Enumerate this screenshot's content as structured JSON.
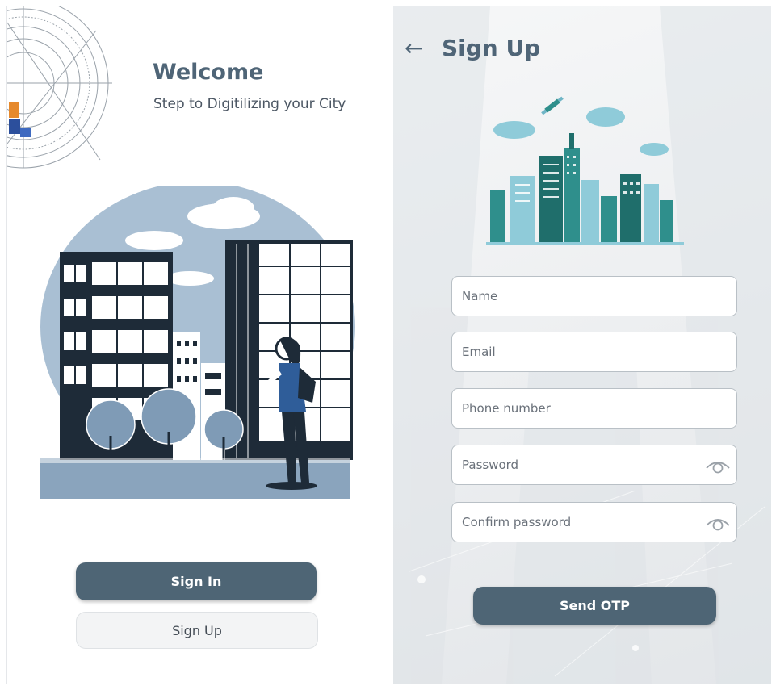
{
  "welcome": {
    "title": "Welcome",
    "subtitle": "Step to Digitilizing your City",
    "buttons": {
      "sign_in": "Sign In",
      "sign_up": "Sign Up"
    }
  },
  "signup": {
    "title": "Sign Up",
    "back_icon": "arrow-left-icon",
    "fields": {
      "name": {
        "placeholder": "Name",
        "value": ""
      },
      "email": {
        "placeholder": "Email",
        "value": ""
      },
      "phone": {
        "placeholder": "Phone number",
        "value": ""
      },
      "password": {
        "placeholder": "Password",
        "value": "",
        "toggle_icon": "eye-icon"
      },
      "confirm_password": {
        "placeholder": "Confirm password",
        "value": "",
        "toggle_icon": "eye-icon"
      }
    },
    "send_otp": "Send OTP"
  },
  "colors": {
    "primary": "#4e6575",
    "heading": "#4f6577",
    "illustration_dark": "#1e2b38",
    "illustration_sky": "#a9bfd3",
    "city_teal": "#2f8f8c",
    "cloud": "#8fcbd9"
  }
}
